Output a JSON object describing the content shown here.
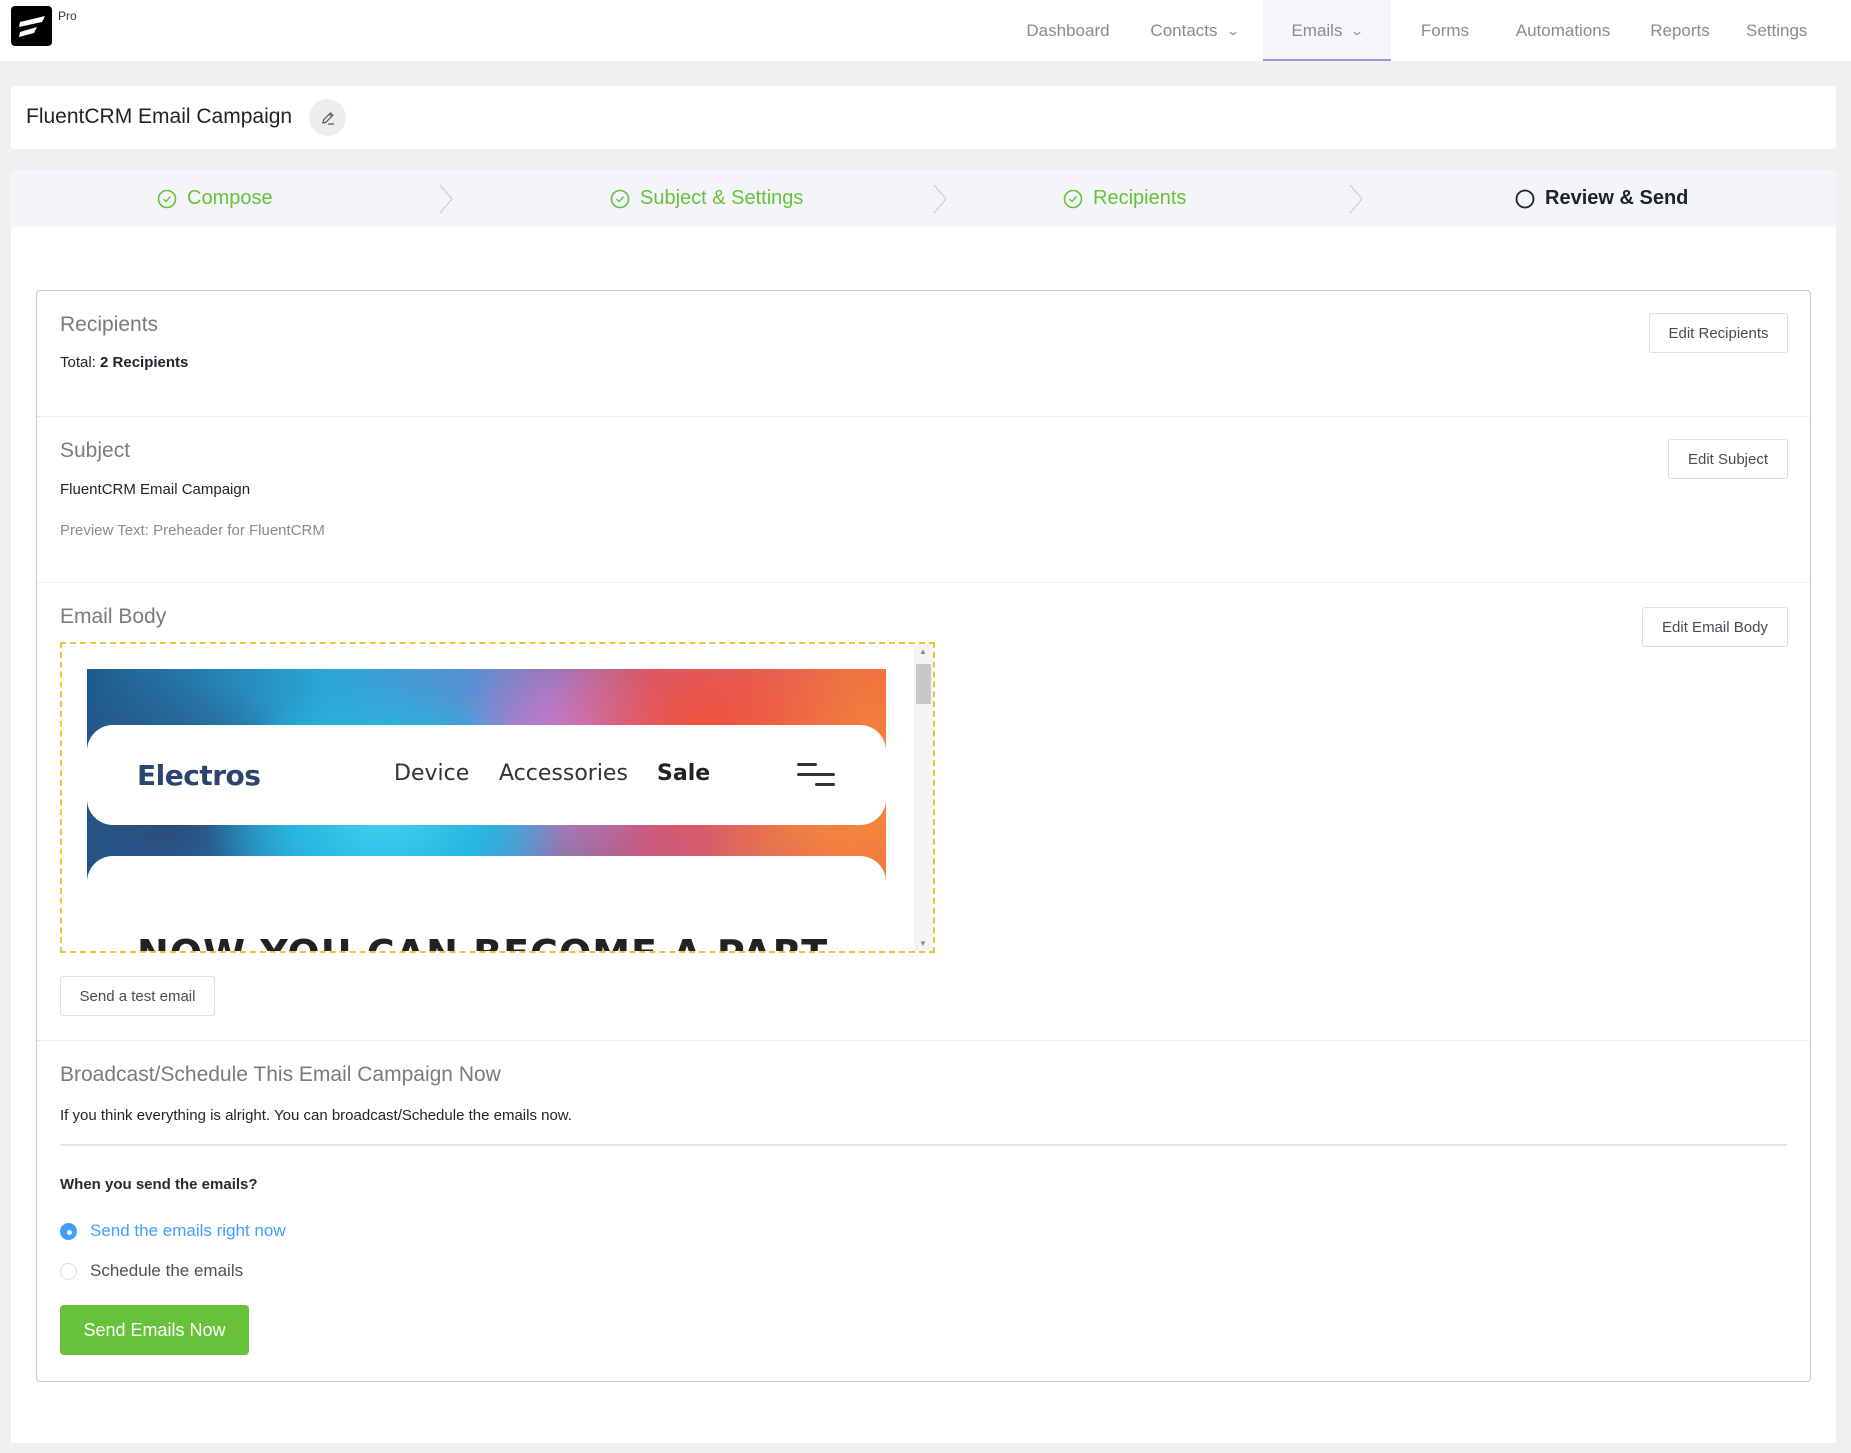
{
  "app": {
    "badge": "Pro",
    "nav": [
      {
        "label": "Dashboard",
        "dropdown": false,
        "active": false
      },
      {
        "label": "Contacts",
        "dropdown": true,
        "active": false
      },
      {
        "label": "Emails",
        "dropdown": true,
        "active": true
      },
      {
        "label": "Forms",
        "dropdown": false,
        "active": false
      },
      {
        "label": "Automations",
        "dropdown": false,
        "active": false
      },
      {
        "label": "Reports",
        "dropdown": false,
        "active": false
      },
      {
        "label": "Settings",
        "dropdown": false,
        "active": false
      }
    ],
    "accent_color": "#9d96d8"
  },
  "campaign": {
    "title": "FluentCRM Email Campaign",
    "edit_icon": "pencil-icon"
  },
  "stepper": {
    "steps": [
      {
        "label": "Compose",
        "status": "done",
        "icon": "check-circle-icon"
      },
      {
        "label": "Subject & Settings",
        "status": "done",
        "icon": "check-circle-icon"
      },
      {
        "label": "Recipients",
        "status": "done",
        "icon": "check-circle-icon"
      },
      {
        "label": "Review & Send",
        "status": "current",
        "icon": "circle-icon"
      }
    ],
    "done_color": "#67c23a"
  },
  "review": {
    "recipients": {
      "title": "Recipients",
      "total_label": "Total:",
      "total_value": "2 Recipients",
      "edit_label": "Edit Recipients"
    },
    "subject": {
      "title": "Subject",
      "value": "FluentCRM Email Campaign",
      "preview_text": "Preview Text: Preheader for FluentCRM",
      "edit_label": "Edit Subject"
    },
    "body": {
      "title": "Email Body",
      "edit_label": "Edit Email Body",
      "preview": {
        "brand": "Electros",
        "nav": [
          "Device",
          "Accessories",
          "Sale"
        ],
        "headline": "NOW YOU CAN BECOME A PART"
      },
      "test_email_label": "Send a test email"
    },
    "broadcast": {
      "title": "Broadcast/Schedule This Email Campaign Now",
      "description": "If you think everything is alright. You can broadcast/Schedule the emails now.",
      "question": "When you send the emails?",
      "options": [
        {
          "label": "Send the emails right now",
          "checked": true
        },
        {
          "label": "Schedule the emails",
          "checked": false
        }
      ],
      "send_label": "Send Emails Now",
      "send_color": "#67c23a"
    }
  }
}
